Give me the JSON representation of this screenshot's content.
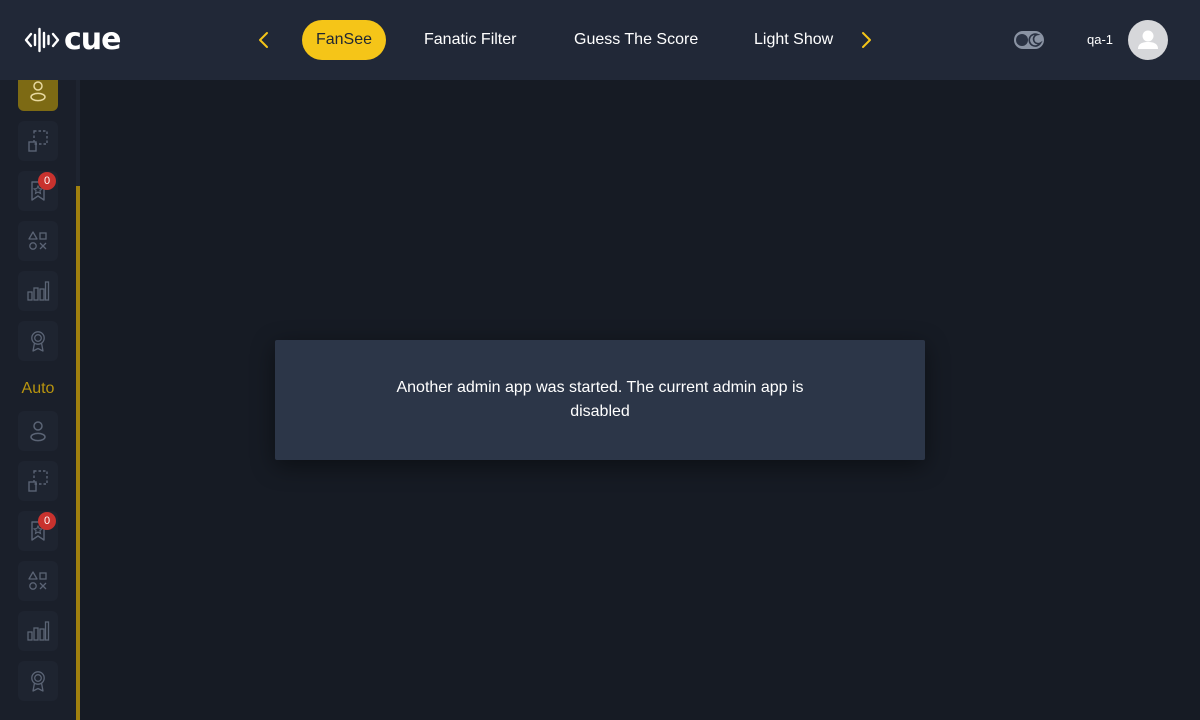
{
  "brand": {
    "name": "cue"
  },
  "nav": {
    "tabs": [
      {
        "label": "FanSee",
        "active": true
      },
      {
        "label": "Fanatic Filter",
        "active": false
      },
      {
        "label": "Guess The Score",
        "active": false
      },
      {
        "label": "Light Show",
        "active": false
      }
    ],
    "prev_icon": "chevron-left-icon",
    "next_icon": "chevron-right-icon"
  },
  "header": {
    "theme_toggle_icon": "moon-icon",
    "username": "qa-1",
    "avatar_icon": "user-icon"
  },
  "sidebar": {
    "group1": {
      "items": [
        {
          "icon": "user-icon",
          "active": true
        },
        {
          "icon": "crop-icon"
        },
        {
          "icon": "ribbon-star-icon",
          "badge": "0"
        },
        {
          "icon": "shapes-icon"
        },
        {
          "icon": "bar-chart-icon"
        },
        {
          "icon": "award-icon"
        }
      ]
    },
    "section_label": "Auto",
    "group2": {
      "items": [
        {
          "icon": "user-icon"
        },
        {
          "icon": "crop-icon"
        },
        {
          "icon": "ribbon-star-icon",
          "badge": "0"
        },
        {
          "icon": "shapes-icon"
        },
        {
          "icon": "bar-chart-icon"
        },
        {
          "icon": "award-icon"
        }
      ]
    }
  },
  "modal": {
    "message": "Another admin app was started. The current admin app is disabled"
  },
  "colors": {
    "accent": "#f5c518",
    "topbar": "#212837",
    "background": "#161b24",
    "modal": "#2c3648",
    "badge": "#c8322e"
  }
}
